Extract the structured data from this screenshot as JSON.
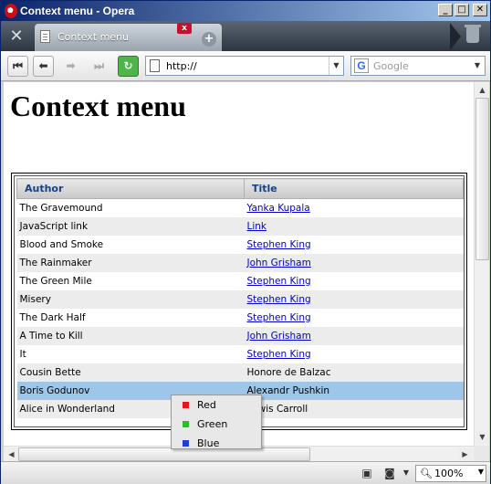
{
  "window": {
    "title": "Context menu - Opera",
    "minimize": "_",
    "maximize": "□",
    "close": "✕"
  },
  "tabs": [
    {
      "label": "Context menu",
      "close": "x"
    }
  ],
  "toolbar": {
    "menu_icon": "✕",
    "back_start": "⏮",
    "back": "⬅",
    "forward": "➡",
    "fast_forward": "⏭",
    "reload": "↻",
    "newtab": "+",
    "address": "http://",
    "search_placeholder": "Google",
    "search_engine_letter": "G"
  },
  "page": {
    "heading": "Context menu",
    "table": {
      "headers": [
        "Author",
        "Title"
      ],
      "rows": [
        {
          "author": "The Gravemound",
          "title": "Yanka Kupala",
          "link": true
        },
        {
          "author": "JavaScript link",
          "title": "Link",
          "link": true
        },
        {
          "author": "Blood and Smoke",
          "title": "Stephen King",
          "link": true
        },
        {
          "author": "The Rainmaker",
          "title": "John Grisham",
          "link": true
        },
        {
          "author": "The Green Mile",
          "title": "Stephen King",
          "link": true
        },
        {
          "author": "Misery",
          "title": "Stephen King",
          "link": true
        },
        {
          "author": "The Dark Half",
          "title": "Stephen King",
          "link": true
        },
        {
          "author": "A Time to Kill",
          "title": "John Grisham",
          "link": true
        },
        {
          "author": "It",
          "title": "Stephen King",
          "link": true
        },
        {
          "author": "Cousin Bette",
          "title": "Honore de Balzac",
          "link": false
        },
        {
          "author": "Boris Godunov",
          "title": "Alexandr Pushkin",
          "link": false,
          "selected": true
        },
        {
          "author": "Alice in Wonderland",
          "title": "Lewis Carroll",
          "link": false
        }
      ]
    }
  },
  "context_menu": {
    "items": [
      {
        "label": "Red",
        "color": "#e8141b"
      },
      {
        "label": "Green",
        "color": "#20c41f"
      },
      {
        "label": "Blue",
        "color": "#1f3fd0"
      }
    ]
  },
  "statusbar": {
    "zoom": "100%"
  },
  "colors": {
    "header_text": "#15428b",
    "selected_row": "#9ec6e8",
    "link": "#0000cc"
  }
}
